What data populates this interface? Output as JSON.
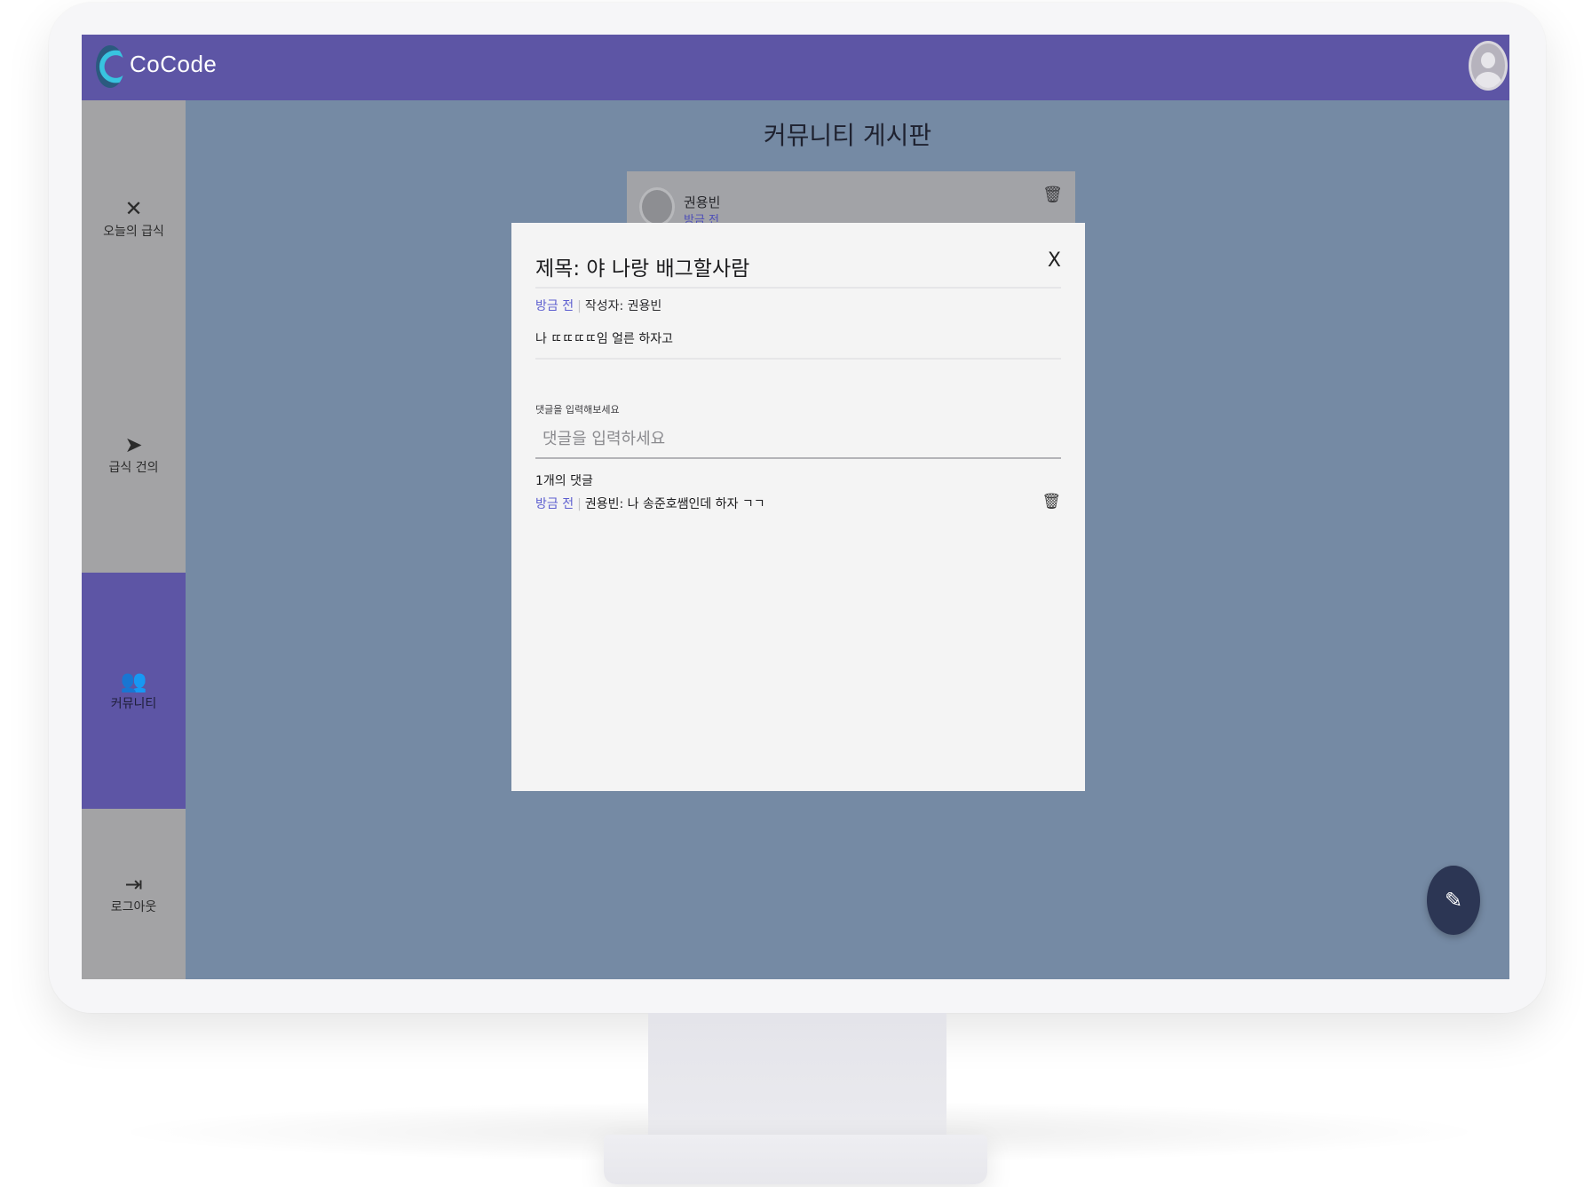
{
  "app": {
    "title": "CoCode"
  },
  "sidebar": {
    "items": [
      {
        "label": "오늘의 급식",
        "icon": "utensils-icon"
      },
      {
        "label": "급식 건의",
        "icon": "send-icon"
      },
      {
        "label": "커뮤니티",
        "icon": "people-icon",
        "active": true
      },
      {
        "label": "로그아웃",
        "icon": "logout-icon"
      }
    ]
  },
  "page": {
    "title": "커뮤니티 게시판"
  },
  "background_post": {
    "author": "권용빈",
    "time": "방금 전"
  },
  "modal": {
    "title": "제목: 야 나랑 배그할사람",
    "close_label": "X",
    "time": "방금 전",
    "author_label": "작성자: 권용빈",
    "body": "나 ㄸㄸㄸㄸ임 얼른 하자고",
    "comment_label": "댓글을 입력해보세요",
    "comment_placeholder": "댓글을 입력하세요",
    "comment_count": "1개의 댓글",
    "comments": [
      {
        "time": "방금 전",
        "author": "권용빈:",
        "text": "나 송준호쌤인데 하자 ㄱㄱ"
      }
    ]
  },
  "colors": {
    "topbar": "#5d55a5",
    "sidebar": "#a3a3a5",
    "overlay_bg": "#758aa4",
    "modal_bg": "#f4f4f4",
    "accent_time": "#5e5fd0",
    "fab": "#2c3654"
  },
  "icons": {
    "fab": "pencil-icon",
    "delete": "trash-icon"
  }
}
